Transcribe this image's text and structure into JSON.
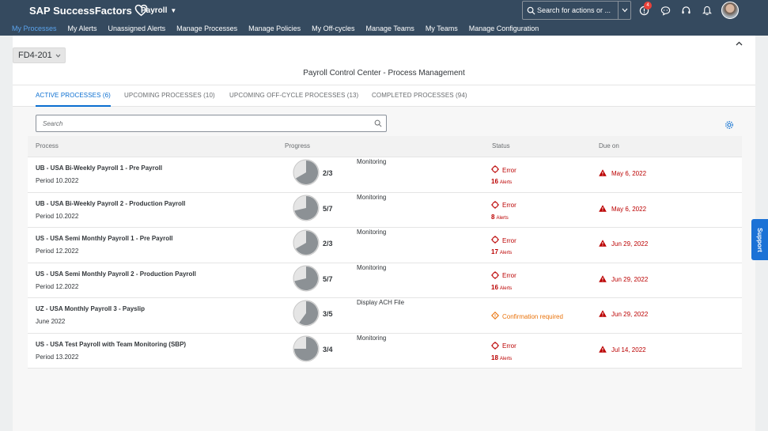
{
  "brand": {
    "name": "SAP SuccessFactors"
  },
  "app_menu": {
    "label": "Payroll"
  },
  "search": {
    "placeholder": "Search for actions or ..."
  },
  "notifications": {
    "count": "4"
  },
  "nav": {
    "items": [
      "My Processes",
      "My Alerts",
      "Unassigned Alerts",
      "Manage Processes",
      "Manage Policies",
      "My Off-cycles",
      "Manage Teams",
      "My Teams",
      "Manage Configuration"
    ],
    "active_index": 0
  },
  "context": {
    "selector": "FD4-201"
  },
  "page": {
    "title": "Payroll Control Center - Process Management"
  },
  "tabs": [
    "ACTIVE PROCESSES (6)",
    "UPCOMING PROCESSES (10)",
    "UPCOMING OFF-CYCLE PROCESSES (13)",
    "COMPLETED PROCESSES (94)"
  ],
  "table": {
    "search_placeholder": "Search",
    "columns": [
      "Process",
      "Progress",
      "Status",
      "Due on"
    ],
    "rows": [
      {
        "name": "UB - USA Bi-Weekly Payroll 1 - Pre Payroll",
        "period": "Period 10.2022",
        "progress": "2/3",
        "ratio": 0.667,
        "stage": "Monitoring",
        "status": "Error",
        "status_type": "error",
        "alerts": "16",
        "alerts_label": "Alerts",
        "due": "May 6, 2022"
      },
      {
        "name": "UB - USA Bi-Weekly Payroll 2 - Production Payroll",
        "period": "Period 10.2022",
        "progress": "5/7",
        "ratio": 0.714,
        "stage": "Monitoring",
        "status": "Error",
        "status_type": "error",
        "alerts": "8",
        "alerts_label": "Alerts",
        "due": "May 6, 2022"
      },
      {
        "name": "US - USA Semi Monthly Payroll 1 - Pre Payroll",
        "period": "Period 12.2022",
        "progress": "2/3",
        "ratio": 0.667,
        "stage": "Monitoring",
        "status": "Error",
        "status_type": "error",
        "alerts": "17",
        "alerts_label": "Alerts",
        "due": "Jun 29, 2022"
      },
      {
        "name": "US - USA Semi Monthly Payroll 2 - Production Payroll",
        "period": "Period 12.2022",
        "progress": "5/7",
        "ratio": 0.714,
        "stage": "Monitoring",
        "status": "Error",
        "status_type": "error",
        "alerts": "16",
        "alerts_label": "Alerts",
        "due": "Jun 29, 2022"
      },
      {
        "name": "UZ - USA Monthly Payroll 3 - Payslip",
        "period": "June 2022",
        "progress": "3/5",
        "ratio": 0.6,
        "stage": "Display ACH File",
        "status": "Confirmation required",
        "status_type": "warn",
        "alerts": "",
        "alerts_label": "",
        "due": "Jun 29, 2022"
      },
      {
        "name": "US - USA Test Payroll with Team Monitoring (SBP)",
        "period": "Period 13.2022",
        "progress": "3/4",
        "ratio": 0.75,
        "stage": "Monitoring",
        "status": "Error",
        "status_type": "error",
        "alerts": "18",
        "alerts_label": "Alerts",
        "due": "Jul 14, 2022"
      }
    ]
  },
  "support": {
    "label": "Support"
  },
  "colors": {
    "shell": "#354a5f",
    "accent": "#0a6ed1",
    "error": "#bb0000",
    "warning": "#e9730c"
  }
}
